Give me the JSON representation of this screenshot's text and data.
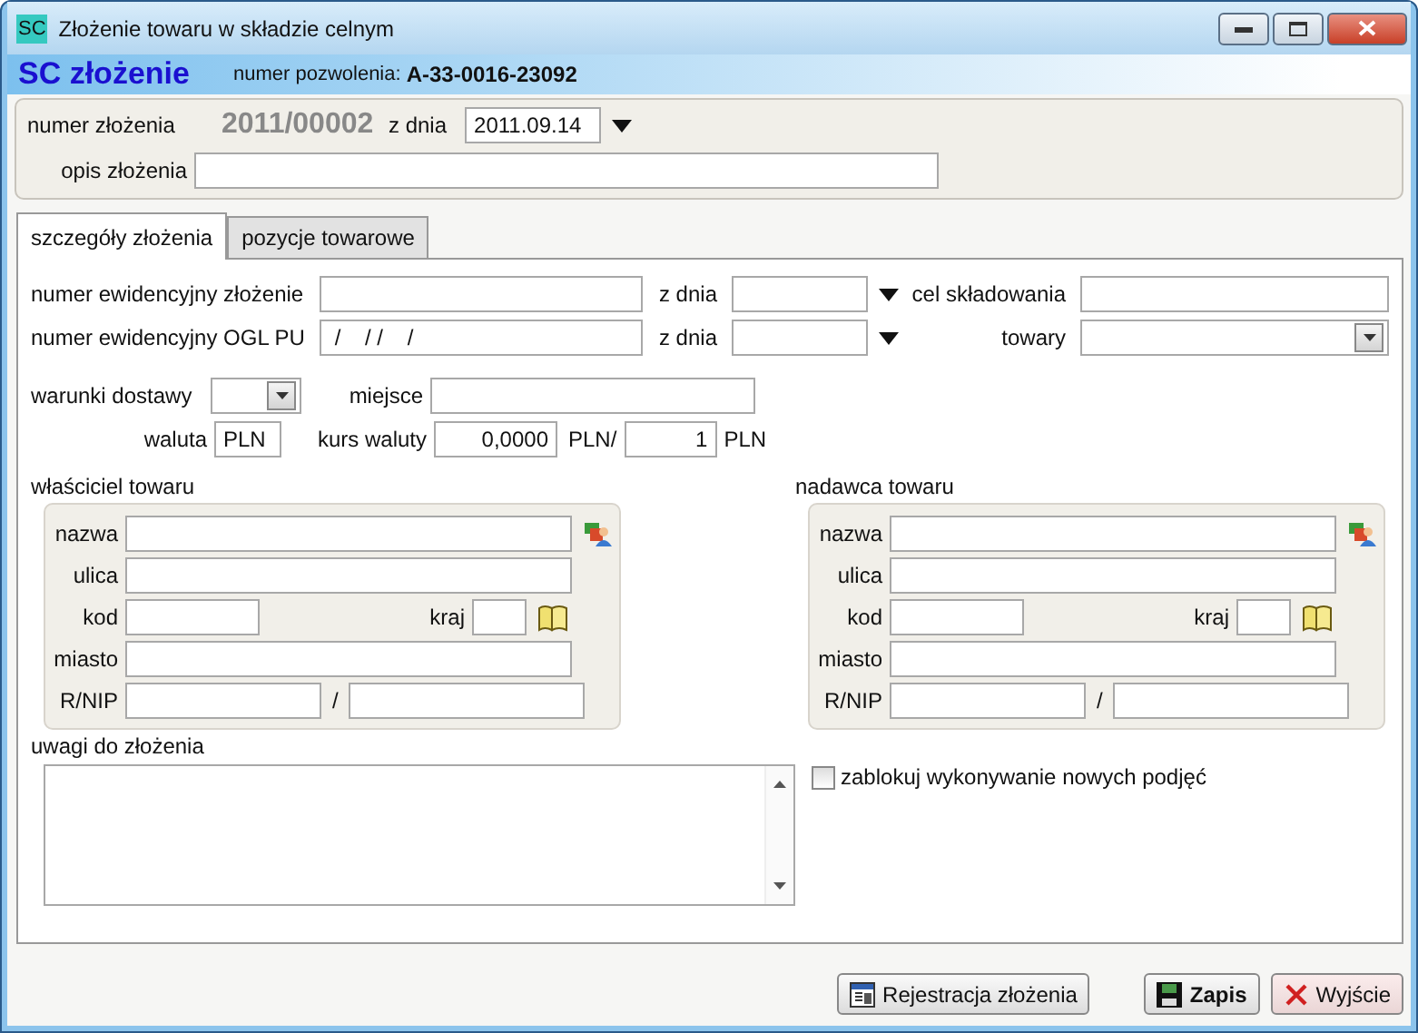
{
  "window": {
    "title": "Złożenie towaru w składzie celnym",
    "icon_text": "SC"
  },
  "header": {
    "title": "SC złożenie",
    "permit_label": "numer pozwolenia:",
    "permit_number": "A-33-0016-23092"
  },
  "top": {
    "number_label": "numer złożenia",
    "number_value": "2011/00002",
    "date_label": "z dnia",
    "date_value": "2011.09.14",
    "description_label": "opis złożenia"
  },
  "tabs": [
    {
      "label": "szczegóły złożenia",
      "selected": true
    },
    {
      "label": "pozycje towarowe",
      "selected": false
    }
  ],
  "details": {
    "reg_number_label": "numer ewidencyjny złożenie",
    "reg_date_label": "z dnia",
    "purpose_label": "cel składowania",
    "ogl_label": "numer ewidencyjny OGL PU",
    "ogl_value": " /    / /    /",
    "ogl_date_label": "z dnia",
    "goods_label": "towary",
    "delivery_label": "warunki dostawy",
    "place_label": "miejsce",
    "currency_label": "waluta",
    "currency_value": "PLN",
    "rate_label": "kurs waluty",
    "rate_value": "0,0000",
    "rate_unit": "PLN/",
    "rate_base": "1",
    "rate_base_unit": "PLN"
  },
  "parties": [
    {
      "title": "właściciel towaru",
      "name_label": "nazwa",
      "street_label": "ulica",
      "code_label": "kod",
      "country_label": "kraj",
      "city_label": "miasto",
      "nip_label": "R/NIP",
      "separator": "/"
    },
    {
      "title": "nadawca towaru",
      "name_label": "nazwa",
      "street_label": "ulica",
      "code_label": "kod",
      "country_label": "kraj",
      "city_label": "miasto",
      "nip_label": "R/NIP",
      "separator": "/"
    }
  ],
  "notes": {
    "label": "uwagi do złożenia"
  },
  "block_checkbox": {
    "label": "zablokuj wykonywanie nowych podjęć",
    "checked": false
  },
  "buttons": [
    {
      "label": "Rejestracja złożenia",
      "kind": "register"
    },
    {
      "label": "Zapis",
      "kind": "save"
    },
    {
      "label": "Wyjście",
      "kind": "exit"
    }
  ]
}
